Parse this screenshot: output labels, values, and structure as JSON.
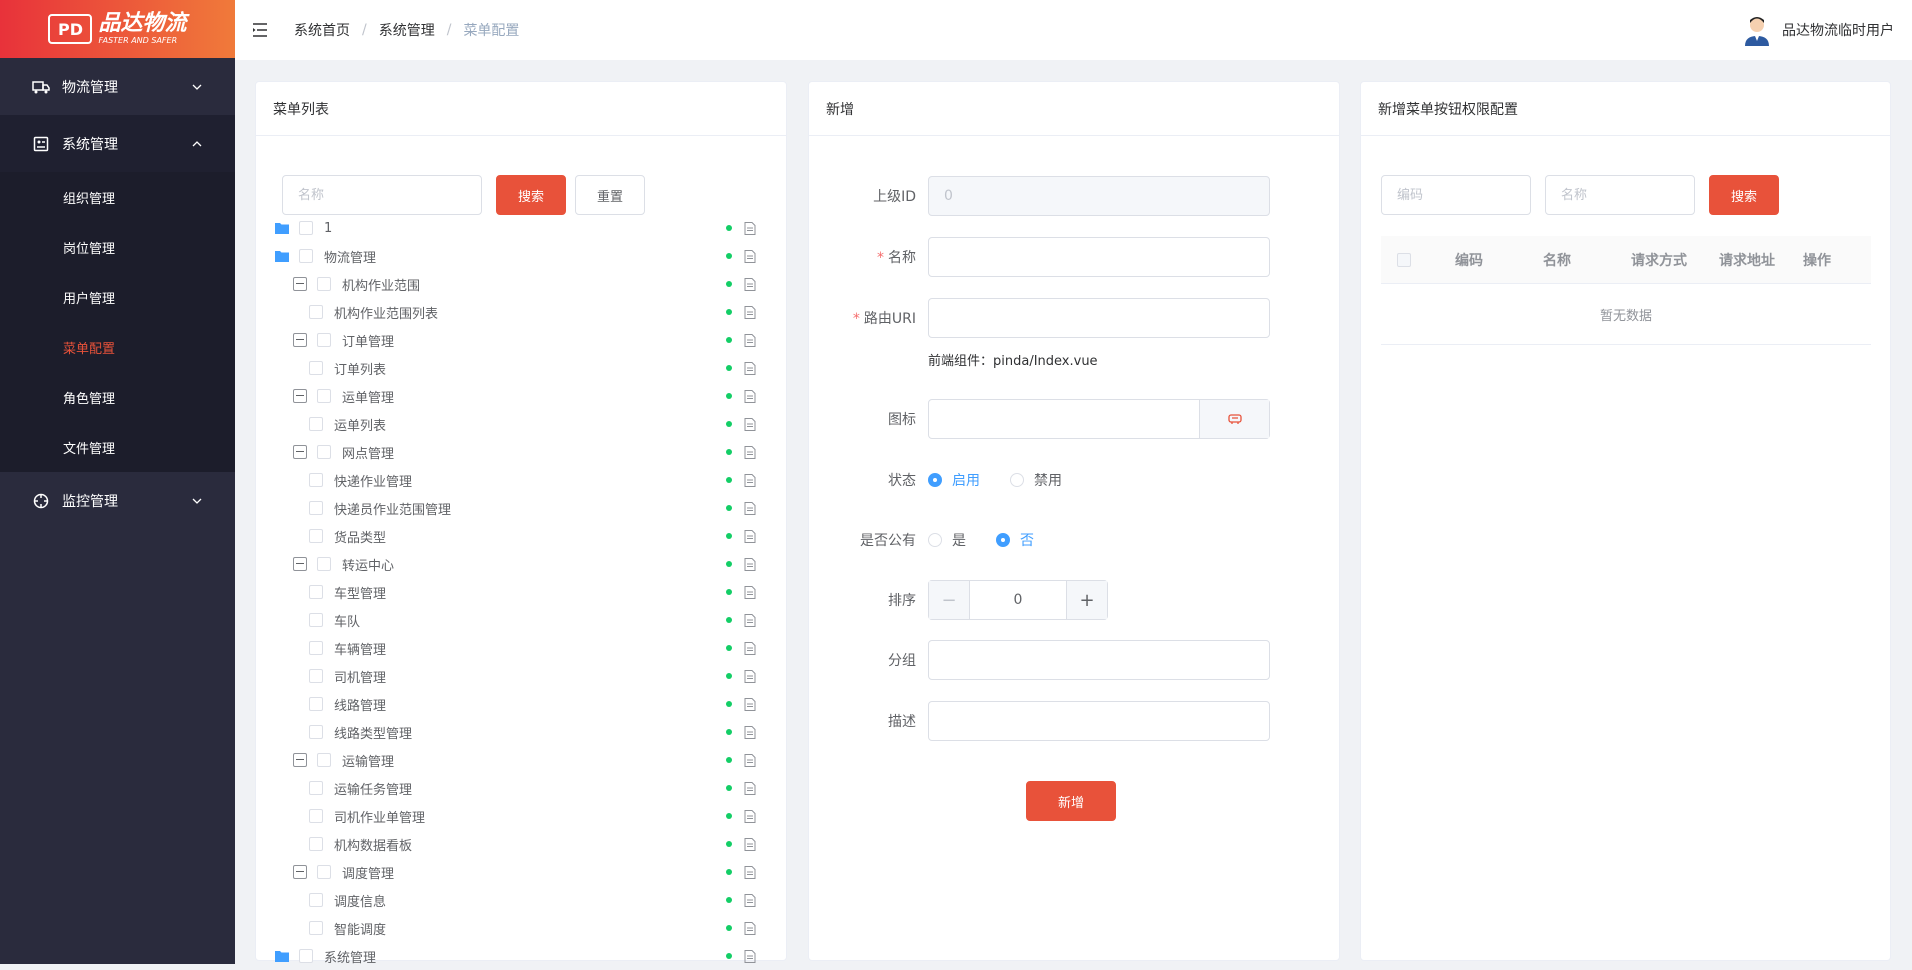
{
  "logo": {
    "badge": "PD",
    "title": "品达物流",
    "subtitle": "FASTER AND SAFER"
  },
  "sidebar": {
    "items": [
      {
        "label": "物流管理",
        "icon": "truck-icon"
      },
      {
        "label": "系统管理",
        "icon": "settings-panel-icon"
      },
      {
        "label": "监控管理",
        "icon": "target-icon"
      }
    ],
    "sub": [
      {
        "label": "组织管理"
      },
      {
        "label": "岗位管理"
      },
      {
        "label": "用户管理"
      },
      {
        "label": "菜单配置"
      },
      {
        "label": "角色管理"
      },
      {
        "label": "文件管理"
      }
    ]
  },
  "header": {
    "breadcrumb": [
      "系统首页",
      "系统管理",
      "菜单配置"
    ],
    "separator": "/",
    "user_name": "品达物流临时用户"
  },
  "menu_list": {
    "title": "菜单列表",
    "search_placeholder": "名称",
    "search_label": "搜索",
    "reset_label": "重置",
    "tree": [
      {
        "label": "1",
        "level": 0
      },
      {
        "label": "物流管理",
        "level": 0
      },
      {
        "label": "机构作业范围",
        "level": 1
      },
      {
        "label": "机构作业范围列表",
        "level": 2
      },
      {
        "label": "订单管理",
        "level": 1
      },
      {
        "label": "订单列表",
        "level": 2
      },
      {
        "label": "运单管理",
        "level": 1
      },
      {
        "label": "运单列表",
        "level": 2
      },
      {
        "label": "网点管理",
        "level": 1
      },
      {
        "label": "快递作业管理",
        "level": 2
      },
      {
        "label": "快递员作业范围管理",
        "level": 2
      },
      {
        "label": "货品类型",
        "level": 2
      },
      {
        "label": "转运中心",
        "level": 1
      },
      {
        "label": "车型管理",
        "level": 2
      },
      {
        "label": "车队",
        "level": 2
      },
      {
        "label": "车辆管理",
        "level": 2
      },
      {
        "label": "司机管理",
        "level": 2
      },
      {
        "label": "线路管理",
        "level": 2
      },
      {
        "label": "线路类型管理",
        "level": 2
      },
      {
        "label": "运输管理",
        "level": 1
      },
      {
        "label": "运输任务管理",
        "level": 2
      },
      {
        "label": "司机作业单管理",
        "level": 2
      },
      {
        "label": "机构数据看板",
        "level": 2
      },
      {
        "label": "调度管理",
        "level": 1
      },
      {
        "label": "调度信息",
        "level": 2
      },
      {
        "label": "智能调度",
        "level": 2
      },
      {
        "label": "系统管理",
        "level": 0
      }
    ]
  },
  "add_form": {
    "title": "新增",
    "parent_id_label": "上级ID",
    "parent_id_value": "0",
    "name_label": "名称",
    "route_label": "路由URI",
    "component_hint": "前端组件：pinda/Index.vue",
    "icon_label": "图标",
    "status_label": "状态",
    "status_on": "启用",
    "status_off": "禁用",
    "public_label": "是否公有",
    "public_yes": "是",
    "public_no": "否",
    "sort_label": "排序",
    "sort_value": "0",
    "sort_minus": "−",
    "sort_plus": "+",
    "group_label": "分组",
    "desc_label": "描述",
    "submit_label": "新增",
    "required_mark": "*"
  },
  "perm_config": {
    "title": "新增菜单按钮权限配置",
    "code_placeholder": "编码",
    "name_placeholder": "名称",
    "search_label": "搜索",
    "columns": [
      "编码",
      "名称",
      "请求方式",
      "请求地址",
      "操作"
    ],
    "empty_text": "暂无数据"
  },
  "colors": {
    "accent": "#e8523a",
    "sidebar_bg": "#2a2b3d",
    "active_blue": "#409eff",
    "status_green": "#13ce66"
  }
}
